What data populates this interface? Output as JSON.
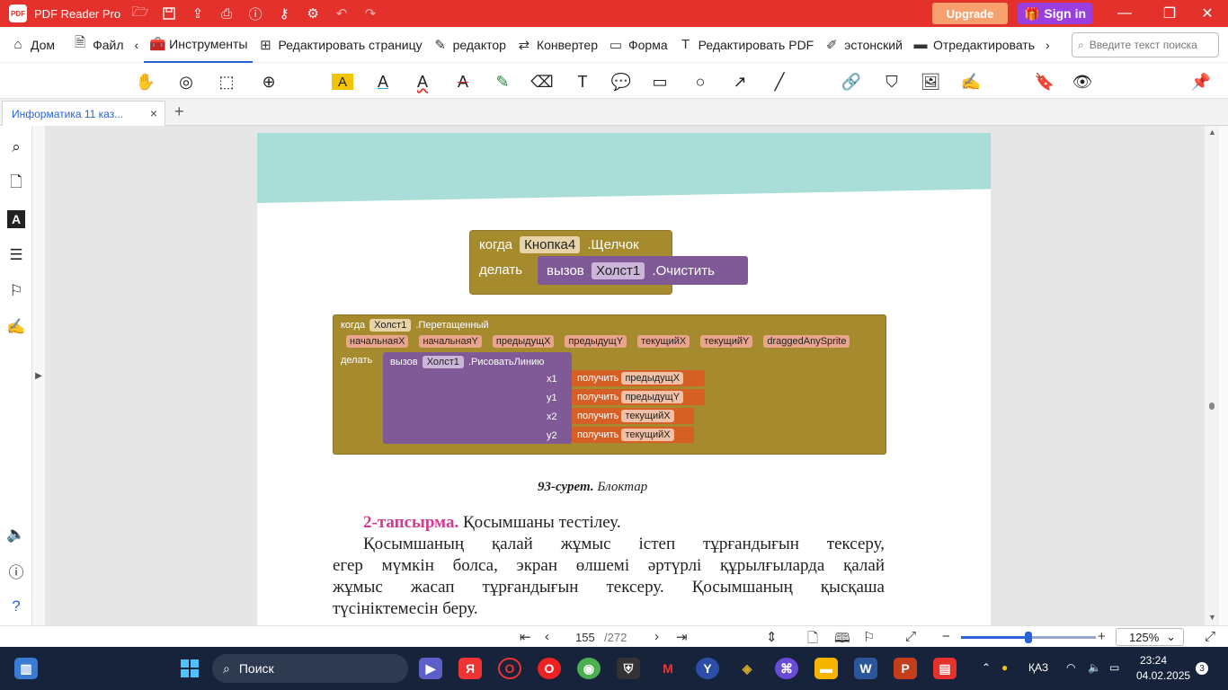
{
  "title_bar": {
    "logo_text": "PDF",
    "app_name": "PDF Reader Pro",
    "upgrade_label": "Upgrade",
    "signin_label": "Sign in",
    "colors": {
      "bar": "#e5312b",
      "upgrade": "#f6a06e",
      "signin": "#9b3ee0"
    }
  },
  "menu": {
    "items": [
      {
        "label": "Дом",
        "icon": "home-icon"
      },
      {
        "label": "Файл",
        "icon": "file-icon"
      },
      {
        "label": "Инструменты",
        "icon": "toolbox-icon"
      },
      {
        "label": "Редактировать страницу",
        "icon": "grid-icon"
      },
      {
        "label": "редактор",
        "icon": "edit-icon"
      },
      {
        "label": "Конвертер",
        "icon": "convert-icon"
      },
      {
        "label": "Форма",
        "icon": "form-icon"
      },
      {
        "label": "Редактировать PDF",
        "icon": "text-edit-icon"
      },
      {
        "label": "эстонский",
        "icon": "translate-icon"
      },
      {
        "label": "Отредактировать",
        "icon": "redact-icon"
      }
    ],
    "search_placeholder": "Введите текст поиска"
  },
  "tab": {
    "label": "Информатика 11 каз...",
    "close": "×",
    "new": "+"
  },
  "document": {
    "block1": {
      "when": "когда",
      "button": "Кнопка4",
      "event": ".Щелчок",
      "do": "делать",
      "call": "вызов",
      "canvas": "Холст1",
      "method": ".Очистить"
    },
    "block2": {
      "when": "когда",
      "canvas": "Холст1",
      "event": ".Перетащенный",
      "params": [
        "начальнаяX",
        "начальнаяY",
        "предыдущX",
        "предыдущY",
        "текущийX",
        "текущийY",
        "draggedAnySprite"
      ],
      "do": "делать",
      "call": "вызов",
      "call_canvas": "Холст1",
      "method": ".РисоватьЛинию",
      "args": [
        {
          "name": "x1",
          "get": "получить",
          "var": "предыдущX"
        },
        {
          "name": "y1",
          "get": "получить",
          "var": "предыдущY"
        },
        {
          "name": "x2",
          "get": "получить",
          "var": "текущийX"
        },
        {
          "name": "y2",
          "get": "получить",
          "var": "текущийX"
        }
      ]
    },
    "caption_bold": "93-сурет.",
    "caption_text": " Блоктар",
    "task_label": "2-тапсырма.",
    "task_title": " Қосымшаны тестілеу.",
    "para_lines": [
      "Қосымшаның қалай жұмыс істеп тұрғандығын тексеру,",
      "егер мүмкін болса, экран өлшемі әртүрлі құрылғыларда қалай",
      "жұмыс жасап тұрғандығын тексеру. Қосымшаның қысқаша",
      "түсініктемесін беру."
    ]
  },
  "status": {
    "current_page": "155",
    "total_pages": "/272",
    "zoom": "125%",
    "zoom_fraction": 0.5
  },
  "taskbar": {
    "search_label": "Поиск",
    "lang": "ҚАЗ",
    "time": "23:24",
    "date": "04.02.2025",
    "notifications": "3"
  }
}
